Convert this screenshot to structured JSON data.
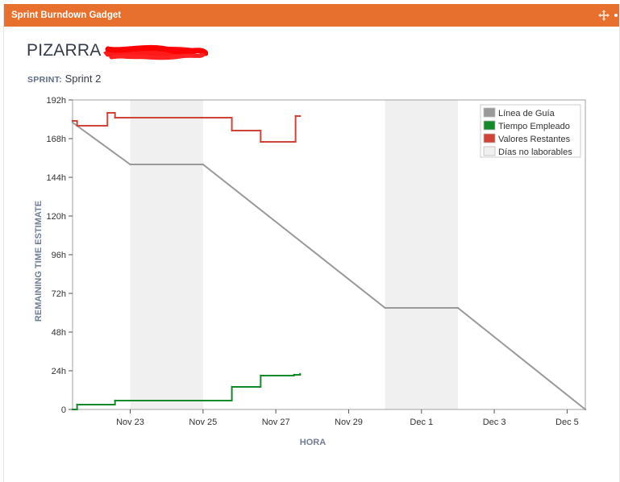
{
  "gadget": {
    "title": "Sprint Burndown Gadget",
    "header_color": "#e8702e",
    "move_icon": "move-arrows-icon",
    "more_icon": "more-dot-icon"
  },
  "board": {
    "title": "PIZARRA"
  },
  "sprint": {
    "label": "SPRINT:",
    "value": "Sprint 2"
  },
  "chart_data": {
    "type": "line",
    "title": "",
    "xlabel": "HORA",
    "ylabel": "REMAINING TIME ESTIMATE",
    "x_unit": "date",
    "xlim": [
      "2023-11-21T10:00",
      "2023-12-05T12:00"
    ],
    "ylim": [
      0,
      192
    ],
    "x_ticks": [
      {
        "date": "2023-11-23",
        "label": "Nov 23"
      },
      {
        "date": "2023-11-25",
        "label": "Nov 25"
      },
      {
        "date": "2023-11-27",
        "label": "Nov 27"
      },
      {
        "date": "2023-11-29",
        "label": "Nov 29"
      },
      {
        "date": "2023-12-01",
        "label": "Dec 1"
      },
      {
        "date": "2023-12-03",
        "label": "Dec 3"
      },
      {
        "date": "2023-12-05",
        "label": "Dec 5"
      }
    ],
    "y_ticks": [
      {
        "value": 0,
        "label": "0"
      },
      {
        "value": 24,
        "label": "24h"
      },
      {
        "value": 48,
        "label": "48h"
      },
      {
        "value": 72,
        "label": "72h"
      },
      {
        "value": 96,
        "label": "96h"
      },
      {
        "value": 120,
        "label": "120h"
      },
      {
        "value": 144,
        "label": "144h"
      },
      {
        "value": 168,
        "label": "168h"
      },
      {
        "value": 192,
        "label": "192h"
      }
    ],
    "grid": false,
    "legend_position": "top-right",
    "non_working_days": [
      {
        "start": "2023-11-23",
        "end": "2023-11-25"
      },
      {
        "start": "2023-11-30",
        "end": "2023-12-02"
      }
    ],
    "series": [
      {
        "name": "Línea de Guía",
        "color": "#999999",
        "step": false,
        "points": [
          {
            "x": "2023-11-21T10:00",
            "y": 178
          },
          {
            "x": "2023-11-23T00:00",
            "y": 152
          },
          {
            "x": "2023-11-25T00:00",
            "y": 152
          },
          {
            "x": "2023-11-30T00:00",
            "y": 63
          },
          {
            "x": "2023-12-02T00:00",
            "y": 63
          },
          {
            "x": "2023-12-05T12:00",
            "y": 0
          }
        ]
      },
      {
        "name": "Tiempo Empleado",
        "color": "#14892c",
        "step": true,
        "points": [
          {
            "x": "2023-11-21T10:00",
            "y": 0
          },
          {
            "x": "2023-11-21T13:00",
            "y": 3
          },
          {
            "x": "2023-11-22T14:00",
            "y": 5.5
          },
          {
            "x": "2023-11-25T19:00",
            "y": 14
          },
          {
            "x": "2023-11-26T14:00",
            "y": 21
          },
          {
            "x": "2023-11-27T12:00",
            "y": 21.5
          },
          {
            "x": "2023-11-27T16:00",
            "y": 22
          }
        ]
      },
      {
        "name": "Valores Restantes",
        "color": "#d04437",
        "step": true,
        "points": [
          {
            "x": "2023-11-21T10:00",
            "y": 179
          },
          {
            "x": "2023-11-21T13:00",
            "y": 176
          },
          {
            "x": "2023-11-22T09:00",
            "y": 184
          },
          {
            "x": "2023-11-22T14:00",
            "y": 181
          },
          {
            "x": "2023-11-25T19:00",
            "y": 173
          },
          {
            "x": "2023-11-26T14:00",
            "y": 166
          },
          {
            "x": "2023-11-27T12:00",
            "y": 166
          },
          {
            "x": "2023-11-27T13:00",
            "y": 182
          },
          {
            "x": "2023-11-27T16:00",
            "y": 182
          }
        ]
      }
    ],
    "legend": [
      {
        "label": "Línea de Guía",
        "color": "#999999"
      },
      {
        "label": "Tiempo Empleado",
        "color": "#14892c"
      },
      {
        "label": "Valores Restantes",
        "color": "#d04437"
      },
      {
        "label": "Días no laborables",
        "color": "#f0f0f0"
      }
    ]
  }
}
